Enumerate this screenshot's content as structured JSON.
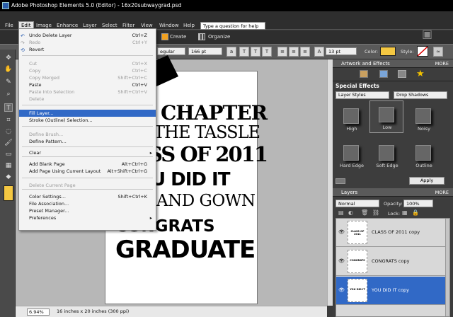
{
  "titlebar": {
    "title": "Adobe Photoshop Elements 5.0 (Editor) - 16x20subwaygrad.psd"
  },
  "menubar": {
    "items": [
      "File",
      "Edit",
      "Image",
      "Enhance",
      "Layer",
      "Select",
      "Filter",
      "View",
      "Window",
      "Help"
    ],
    "help_search": "Type a question for help"
  },
  "shortcuts": {
    "create": "Create",
    "organize": "Organize"
  },
  "options": {
    "font_style": "egular",
    "font_size": "166 pt",
    "leading": "13 pt",
    "color_label": "Color:",
    "style_label": "Style:",
    "color_hex": "#f5c842"
  },
  "edit_menu": {
    "items": [
      {
        "label": "Undo Delete Layer",
        "shortcut": "Ctrl+Z",
        "enabled": true,
        "icon": "undo-icon"
      },
      {
        "label": "Redo",
        "shortcut": "Ctrl+Y",
        "enabled": false,
        "icon": "redo-icon"
      },
      {
        "label": "Revert",
        "shortcut": "",
        "enabled": true,
        "icon": "revert-icon"
      },
      {
        "label": "Cut",
        "shortcut": "Ctrl+X",
        "enabled": false
      },
      {
        "label": "Copy",
        "shortcut": "Ctrl+C",
        "enabled": false
      },
      {
        "label": "Copy Merged",
        "shortcut": "Shift+Ctrl+C",
        "enabled": false
      },
      {
        "label": "Paste",
        "shortcut": "Ctrl+V",
        "enabled": true
      },
      {
        "label": "Paste Into Selection",
        "shortcut": "Shift+Ctrl+V",
        "enabled": false
      },
      {
        "label": "Delete",
        "shortcut": "",
        "enabled": false
      },
      {
        "label": "Fill Layer...",
        "shortcut": "",
        "enabled": true,
        "highlighted": true
      },
      {
        "label": "Stroke (Outline) Selection...",
        "shortcut": "",
        "enabled": true
      },
      {
        "label": "Define Brush...",
        "shortcut": "",
        "enabled": false
      },
      {
        "label": "Define Pattern...",
        "shortcut": "",
        "enabled": true
      },
      {
        "label": "Clear",
        "shortcut": "",
        "enabled": true,
        "submenu": true
      },
      {
        "label": "Add Blank Page",
        "shortcut": "Alt+Ctrl+G",
        "enabled": true
      },
      {
        "label": "Add Page Using Current Layout",
        "shortcut": "Alt+Shift+Ctrl+G",
        "enabled": true
      },
      {
        "label": "Delete Current Page",
        "shortcut": "",
        "enabled": false
      },
      {
        "label": "Color Settings...",
        "shortcut": "Shift+Ctrl+K",
        "enabled": true
      },
      {
        "label": "File Association...",
        "shortcut": "",
        "enabled": true
      },
      {
        "label": "Preset Manager...",
        "shortcut": "",
        "enabled": true
      },
      {
        "label": "Preferences",
        "shortcut": "",
        "enabled": true,
        "submenu": true
      }
    ]
  },
  "document": {
    "lines": [
      "CHAPTER",
      "THE TASSLE",
      "SS OF 2011",
      "U DID IT",
      "AND GOWN",
      "CONGRATS",
      "GRADUATE"
    ]
  },
  "statusbar": {
    "zoom": "6.94%",
    "info": "16 inches x 20 inches (300 ppi)"
  },
  "artwork_panel": {
    "title": "Artwork and Effects",
    "more": "MORE",
    "section": "Special Effects",
    "category": "Layer Styles",
    "subcategory": "Drop Shadows",
    "effects": [
      "High",
      "Low",
      "Noisy",
      "Hard Edge",
      "Soft Edge",
      "Outline"
    ],
    "apply": "Apply"
  },
  "layers_panel": {
    "title": "Layers",
    "more": "MORE",
    "blend_mode": "Normal",
    "opacity_label": "Opacity:",
    "opacity": "100%",
    "lock_label": "Lock:",
    "layers": [
      {
        "name": "CLASS OF 2011 copy",
        "thumb": "CLASS OF 2011",
        "selected": false
      },
      {
        "name": "CONGRATS copy",
        "thumb": "CONGRATS",
        "selected": false
      },
      {
        "name": "YOU DID IT copy",
        "thumb": "YOU DID IT",
        "selected": true
      }
    ]
  }
}
